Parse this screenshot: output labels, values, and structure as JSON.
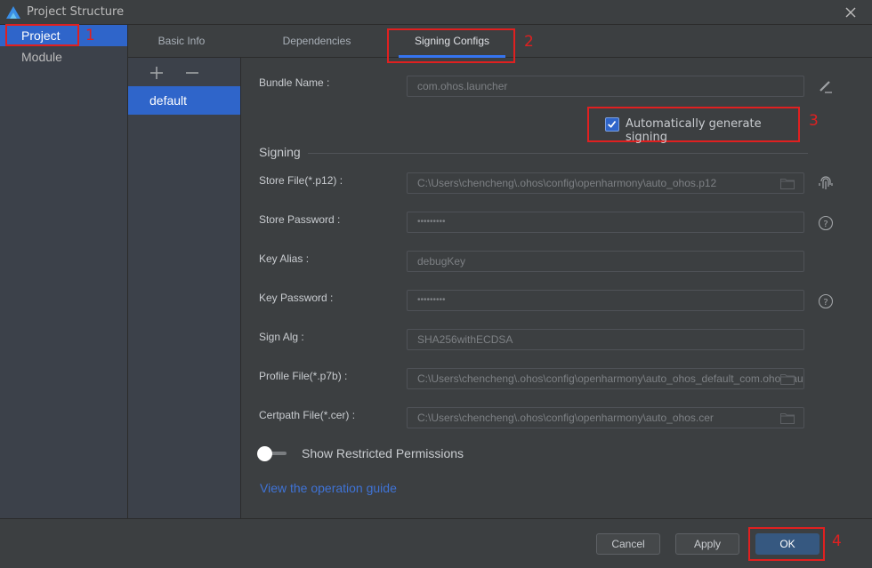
{
  "window": {
    "title": "Project Structure",
    "icons": {
      "logo": "app-logo-icon",
      "close": "close-icon"
    }
  },
  "leftnav": {
    "items": [
      {
        "label": "Project",
        "active": true
      },
      {
        "label": "Module",
        "active": false
      }
    ]
  },
  "tabs": [
    {
      "label": "Basic Info",
      "active": false
    },
    {
      "label": "Dependencies",
      "active": false
    },
    {
      "label": "Signing Configs",
      "active": true
    }
  ],
  "config_list": {
    "add_icon": "plus-icon",
    "remove_icon": "minus-icon",
    "items": [
      {
        "label": "default",
        "selected": true
      }
    ]
  },
  "form": {
    "bundle_name": {
      "label": "Bundle Name",
      "value": "com.ohos.launcher",
      "action_icon": "edit-icon"
    },
    "auto_generate": {
      "label": "Automatically generate signing",
      "checked": true
    },
    "section_title": "Signing",
    "fields": [
      {
        "label": "Store File(*.p12)",
        "value": "C:\\Users\\chencheng\\.ohos\\config\\openharmony\\auto_ohos.p12",
        "folder_icon": true,
        "side_icon": "fingerprint-icon"
      },
      {
        "label": "Store Password",
        "value": "•••••••••",
        "password": true,
        "side_icon": "help-icon"
      },
      {
        "label": "Key Alias",
        "value": "debugKey"
      },
      {
        "label": "Key Password",
        "value": "•••••••••",
        "password": true,
        "side_icon": "help-icon"
      },
      {
        "label": "Sign Alg",
        "value": "SHA256withECDSA"
      },
      {
        "label": "Profile File(*.p7b)",
        "value": "C:\\Users\\chencheng\\.ohos\\config\\openharmony\\auto_ohos_default_com.ohos.launcher",
        "folder_icon": true
      },
      {
        "label": "Certpath File(*.cer)",
        "value": "C:\\Users\\chencheng\\.ohos\\config\\openharmony\\auto_ohos.cer",
        "folder_icon": true
      }
    ],
    "label_suffix": " :",
    "restricted_toggle": {
      "label": "Show Restricted Permissions",
      "on": false
    },
    "guide_link": "View the operation guide"
  },
  "footer": {
    "cancel": "Cancel",
    "apply": "Apply",
    "ok": "OK"
  },
  "annotations": [
    "1",
    "2",
    "3",
    "4"
  ],
  "colors": {
    "accent": "#2f65ca",
    "annotation": "#e02020",
    "link": "#3f73d6",
    "primary_button": "#365880"
  }
}
